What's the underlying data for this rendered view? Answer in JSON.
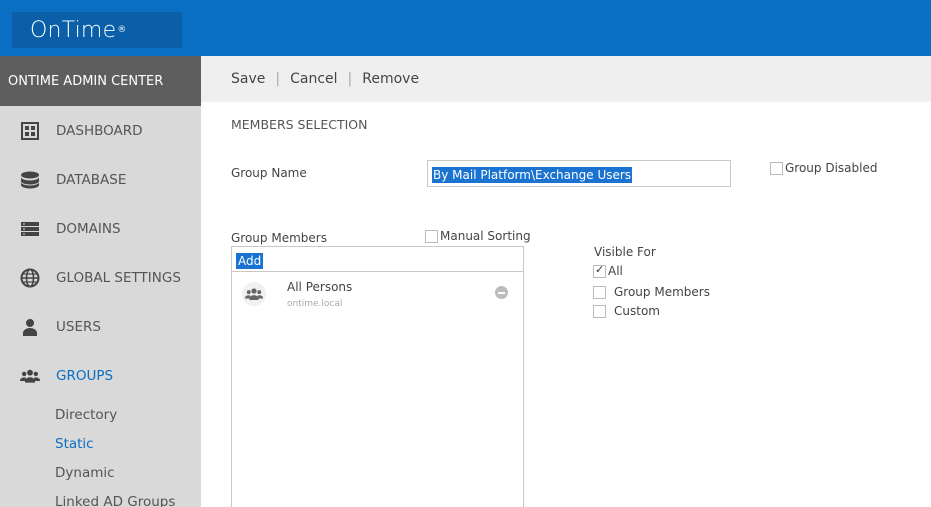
{
  "app": {
    "logo": "OnTime",
    "logo_mark": "®"
  },
  "sidebar": {
    "header": "ONTIME ADMIN CENTER",
    "items": [
      {
        "label": "DASHBOARD",
        "icon": "dashboard-icon"
      },
      {
        "label": "DATABASE",
        "icon": "database-icon"
      },
      {
        "label": "DOMAINS",
        "icon": "domains-icon"
      },
      {
        "label": "GLOBAL SETTINGS",
        "icon": "globe-icon"
      },
      {
        "label": "USERS",
        "icon": "user-icon"
      },
      {
        "label": "GROUPS",
        "icon": "group-icon",
        "active": true
      }
    ],
    "sub_items": [
      {
        "label": "Directory"
      },
      {
        "label": "Static",
        "active": true
      },
      {
        "label": "Dynamic"
      },
      {
        "label": "Linked AD Groups"
      }
    ]
  },
  "toolbar": {
    "save": "Save",
    "cancel": "Cancel",
    "remove": "Remove",
    "separator": "|"
  },
  "form": {
    "section_title": "MEMBERS SELECTION",
    "group_name_label": "Group Name",
    "group_name_value": "By Mail Platform\\Exchange Users",
    "group_disabled_label": "Group Disabled",
    "group_disabled_checked": false,
    "group_members_label": "Group Members",
    "manual_sorting_label": "Manual Sorting",
    "manual_sorting_checked": false,
    "add_value": "Add",
    "visible_for": {
      "label": "Visible For",
      "options": [
        {
          "label": "All",
          "checked": true
        },
        {
          "label": "Group Members",
          "checked": false
        },
        {
          "label": "Custom",
          "checked": false
        }
      ]
    },
    "members": [
      {
        "name": "All Persons",
        "domain": "ontime.local"
      }
    ]
  },
  "colors": {
    "brand": "#0a6fc2",
    "sidebar_header": "#5e5e5e",
    "sidebar_bg": "#d9d9d9",
    "selection": "#1a73d1"
  }
}
